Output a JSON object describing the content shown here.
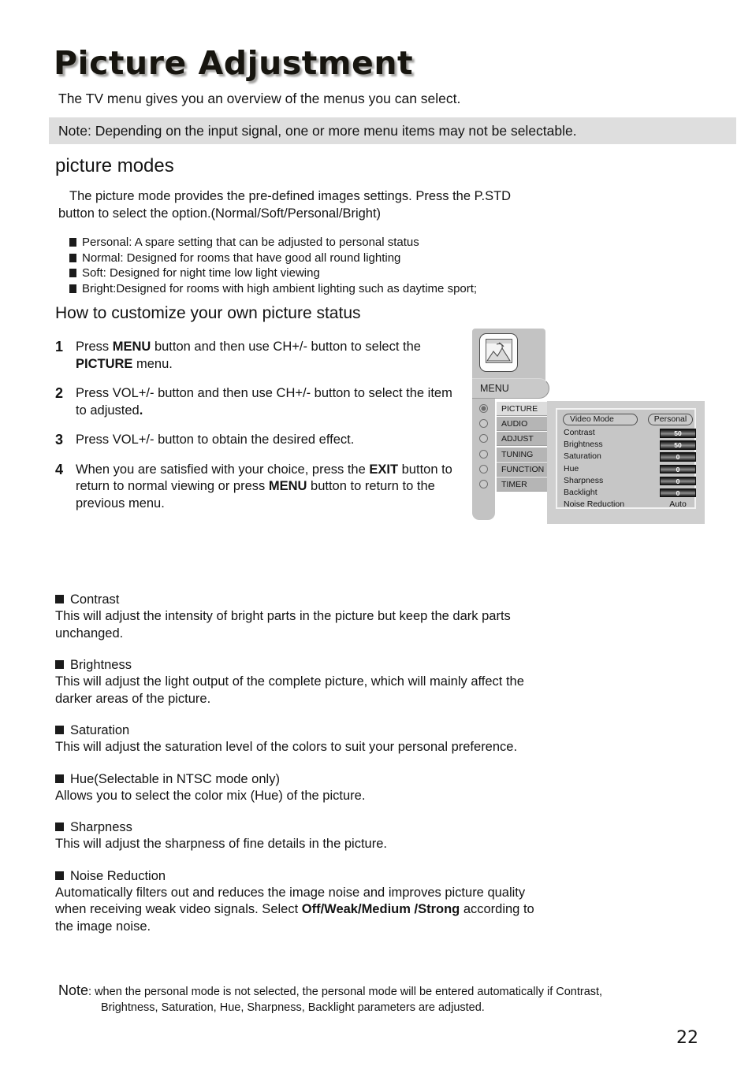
{
  "page": {
    "title": "Picture Adjustment",
    "intro": "The TV menu gives you an overview of the menus you can select.",
    "note_bar": "Note: Depending on the input signal, one or more menu items may not be selectable.",
    "page_number": "22"
  },
  "picture_modes": {
    "heading": "picture modes",
    "paragraph_line1": "The picture mode provides the pre-defined images settings. Press the P.STD",
    "paragraph_line2": "button to select the option.(Normal/Soft/Personal/Bright)",
    "bullets": [
      "Personal: A spare setting that can be adjusted to personal status",
      "Normal: Designed for rooms that have good all round lighting",
      "Soft: Designed for night time low light viewing",
      "Bright:Designed for rooms with high ambient lighting such as daytime sport;"
    ]
  },
  "customize": {
    "heading": "How to customize your own picture status",
    "steps": [
      {
        "num": "1",
        "parts": [
          {
            "t": "Press ",
            "b": false
          },
          {
            "t": "MENU",
            "b": true
          },
          {
            "t": " button and then use CH+/- button to select the ",
            "b": false
          },
          {
            "t": "PICTURE",
            "b": true
          },
          {
            "t": " menu.",
            "b": false
          }
        ]
      },
      {
        "num": "2",
        "parts": [
          {
            "t": "Press VOL+/- button and then use CH+/- button to select the item to adjusted",
            "b": false
          },
          {
            "t": ".",
            "b": true
          }
        ]
      },
      {
        "num": "3",
        "parts": [
          {
            "t": "Press VOL+/- button to obtain the desired effect.",
            "b": false
          }
        ]
      },
      {
        "num": "4",
        "parts": [
          {
            "t": "When you are satisfied with your choice, press the ",
            "b": false
          },
          {
            "t": "EXIT",
            "b": true
          },
          {
            "t": " button to return to normal viewing or press ",
            "b": false
          },
          {
            "t": "MENU",
            "b": true
          },
          {
            "t": " button to return to the previous menu.",
            "b": false
          }
        ]
      }
    ]
  },
  "osd_diagram": {
    "menu_tab_label": "MENU",
    "icon_name": "picture-landscape-icon",
    "nav_items": [
      {
        "label": "PICTURE",
        "selected": true
      },
      {
        "label": "AUDIO",
        "selected": false
      },
      {
        "label": "ADJUST",
        "selected": false
      },
      {
        "label": "TUNING",
        "selected": false
      },
      {
        "label": "FUNCTION",
        "selected": false
      },
      {
        "label": "TIMER",
        "selected": false
      }
    ],
    "video_mode": {
      "label": "Video Mode",
      "value": "Personal"
    },
    "settings": [
      {
        "label": "Contrast",
        "value": "50",
        "style": "bar"
      },
      {
        "label": "Brightness",
        "value": "50",
        "style": "bar"
      },
      {
        "label": "Saturation",
        "value": "0",
        "style": "bar"
      },
      {
        "label": "Hue",
        "value": "0",
        "style": "bar"
      },
      {
        "label": "Sharpness",
        "value": "0",
        "style": "bar"
      },
      {
        "label": "Backlight",
        "value": "0",
        "style": "bar"
      },
      {
        "label": "Noise Reduction",
        "value": "Auto",
        "style": "plain"
      }
    ]
  },
  "descriptions": [
    {
      "title": "Contrast",
      "parts": [
        {
          "t": "This will adjust the intensity of bright parts in the picture but keep the dark parts unchanged.",
          "b": false
        }
      ]
    },
    {
      "title": "Brightness",
      "parts": [
        {
          "t": "This will adjust the light output of the complete picture, which will mainly affect the darker areas of the picture.",
          "b": false
        }
      ]
    },
    {
      "title": "Saturation",
      "parts": [
        {
          "t": "This will adjust the saturation level of the colors to suit your personal preference.",
          "b": false
        }
      ]
    },
    {
      "title": "Hue(Selectable in NTSC mode only)",
      "parts": [
        {
          "t": "Allows you to select the color mix (Hue) of the picture.",
          "b": false
        }
      ]
    },
    {
      "title": "Sharpness",
      "parts": [
        {
          "t": "This will adjust the sharpness of fine details in the picture.",
          "b": false
        }
      ]
    },
    {
      "title": "Noise Reduction",
      "parts": [
        {
          "t": "Automatically filters out and reduces the image noise and improves picture quality when receiving weak video signals. Select ",
          "b": false
        },
        {
          "t": "Off/Weak/Medium /Strong",
          "b": true
        },
        {
          "t": " according to the image noise.",
          "b": false
        }
      ]
    }
  ],
  "final_note": {
    "label": "Note",
    "line1": ": when the personal mode is not selected, the personal mode will be entered automatically if Contrast,",
    "line2": "Brightness, Saturation, Hue, Sharpness, Backlight parameters are adjusted."
  }
}
